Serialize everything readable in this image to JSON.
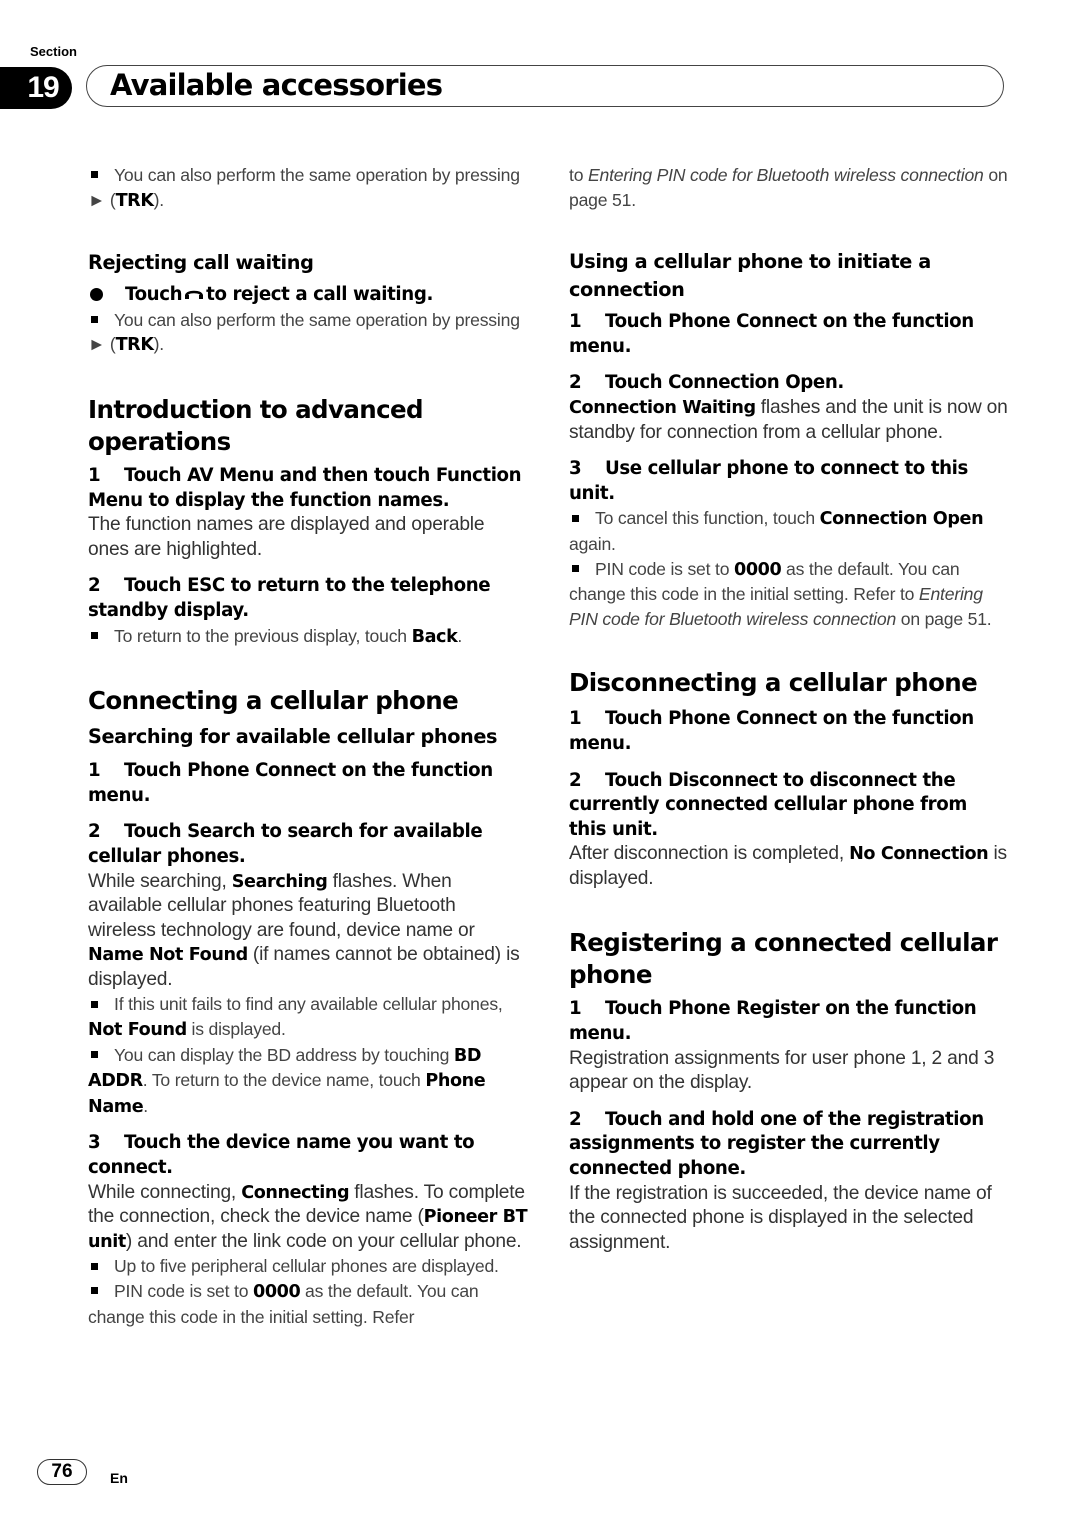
{
  "header": {
    "section_label": "Section",
    "section_number": "19",
    "title": "Available accessories"
  },
  "left": {
    "note_trk_1": {
      "a": "You can also perform the same operation by pressing ",
      "arrow": "►",
      "b": " (",
      "bold": "TRK",
      "c": ")."
    },
    "rejecting": {
      "title": "Rejecting call waiting",
      "bullet_a": "Touch",
      "icon": "hang-up-phone-icon",
      "bullet_b": "to reject a call waiting.",
      "note": {
        "a": "You can also perform the same operation by pressing ",
        "arrow": "►",
        "b": " (",
        "bold": "TRK",
        "c": ")."
      }
    },
    "intro": {
      "title": "Introduction to advanced operations",
      "step1": {
        "num": "1",
        "text": "Touch AV Menu and then touch Function Menu to display the function names."
      },
      "step1_body": "The function names are displayed and operable ones are highlighted.",
      "step2": {
        "num": "2",
        "text": "Touch ESC to return to the telephone standby display."
      },
      "step2_note": {
        "a": "To return to the previous display, touch ",
        "bold": "Back",
        "b": "."
      }
    },
    "connecting": {
      "title": "Connecting a cellular phone",
      "subtitle": "Searching for available cellular phones",
      "step1": {
        "num": "1",
        "text": "Touch Phone Connect on the function menu."
      },
      "step2": {
        "num": "2",
        "text": "Touch Search to search for available cellular phones."
      },
      "step2_body": {
        "a": "While searching, ",
        "bold1": "Searching",
        "b": " flashes. When available cellular phones featuring Bluetooth wireless technology are found, device name or ",
        "bold2": "Name Not Found",
        "c": " (if names cannot be obtained) is displayed."
      },
      "note_notfound": {
        "a": "If this unit fails to find any available cellular phones, ",
        "bold": "Not Found",
        "b": " is displayed."
      },
      "note_bdaddr": {
        "a": "You can display the BD address by touching ",
        "bold1": "BD ADDR",
        "b": ". To return to the device name, touch ",
        "bold2": "Phone Name",
        "c": "."
      },
      "step3": {
        "num": "3",
        "text": "Touch the device name you want to connect."
      },
      "step3_body": {
        "a": "While connecting, ",
        "bold1": "Connecting",
        "b": " flashes. To complete the connection, check the device name (",
        "bold2": "Pioneer BT unit",
        "c": ") and enter the link code on your cellular phone."
      },
      "note_five": "Up to five peripheral cellular phones are displayed.",
      "note_pin": {
        "a": "PIN code is set to ",
        "bold": "0000",
        "b": " as the default. You can change this code in the initial setting. Refer"
      }
    }
  },
  "right": {
    "continued": {
      "a": "to ",
      "italic": "Entering PIN code for Bluetooth wireless connection",
      "b": " on page 51."
    },
    "initiate": {
      "title": "Using a cellular phone to initiate a connection",
      "step1": {
        "num": "1",
        "text": "Touch Phone Connect on the function menu."
      },
      "step2": {
        "num": "2",
        "text": "Touch Connection Open."
      },
      "step2_body": {
        "bold": "Connection Waiting",
        "a": " flashes and the unit is now on standby for connection from a cellular phone."
      },
      "step3": {
        "num": "3",
        "text": "Use cellular phone to connect to this unit."
      },
      "note_cancel": {
        "a": "To cancel this function, touch ",
        "bold": "Connection Open",
        "b": " again."
      },
      "note_pin": {
        "a": "PIN code is set to ",
        "bold": "0000",
        "b": " as the default. You can change this code in the initial setting. Refer to ",
        "italic": "Entering PIN code for Bluetooth wireless connection",
        "c": " on page 51."
      }
    },
    "disconnecting": {
      "title": "Disconnecting a cellular phone",
      "step1": {
        "num": "1",
        "text": "Touch Phone Connect on the function menu."
      },
      "step2": {
        "num": "2",
        "text": "Touch Disconnect to disconnect the currently connected cellular phone from this unit."
      },
      "step2_body": {
        "a": "After disconnection is completed, ",
        "bold": "No Connection",
        "b": " is displayed."
      }
    },
    "registering": {
      "title": "Registering a connected cellular phone",
      "step1": {
        "num": "1",
        "text": "Touch Phone Register on the function menu."
      },
      "step1_body": "Registration assignments for user phone 1, 2 and 3 appear on the display.",
      "step2": {
        "num": "2",
        "text": "Touch and hold one of the registration assignments to register the currently connected phone."
      },
      "step2_body": "If the registration is succeeded, the device name of the connected phone is displayed in the selected assignment."
    }
  },
  "footer": {
    "page_number": "76",
    "language": "En"
  }
}
